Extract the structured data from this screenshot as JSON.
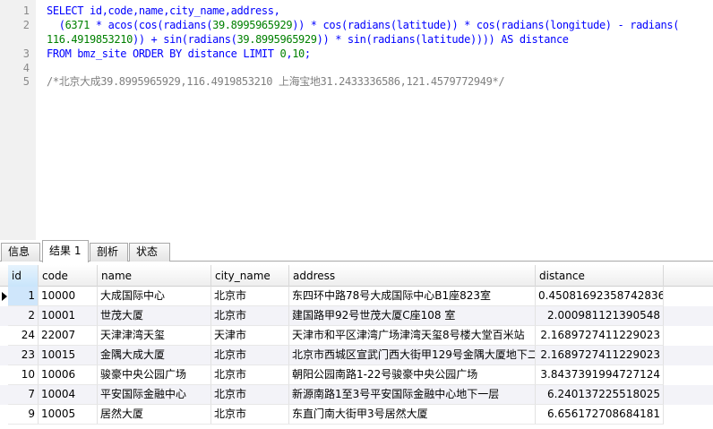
{
  "editor": {
    "lines": [
      {
        "num": "1",
        "segments": [
          {
            "text": "SELECT id,code,name,city_name,address,",
            "cls": "kw"
          }
        ]
      },
      {
        "num": "2",
        "segments": [
          {
            "text": "  (",
            "cls": "kw"
          },
          {
            "text": "6371",
            "cls": "num"
          },
          {
            "text": " * acos(cos(radians(",
            "cls": "kw"
          },
          {
            "text": "39.8995965929",
            "cls": "num"
          },
          {
            "text": ")) * cos(radians(latitude)) * cos(radians(longitude) - radians(",
            "cls": "kw"
          }
        ]
      },
      {
        "num": "",
        "segments": [
          {
            "text": "116.4919853210",
            "cls": "num"
          },
          {
            "text": ")) + sin(radians(",
            "cls": "kw"
          },
          {
            "text": "39.8995965929",
            "cls": "num"
          },
          {
            "text": ")) * sin(radians(latitude)))) AS distance",
            "cls": "kw"
          }
        ]
      },
      {
        "num": "3",
        "segments": [
          {
            "text": "FROM bmz_site ORDER BY distance LIMIT ",
            "cls": "kw"
          },
          {
            "text": "0",
            "cls": "num"
          },
          {
            "text": ",",
            "cls": "kw"
          },
          {
            "text": "10",
            "cls": "num"
          },
          {
            "text": ";",
            "cls": "kw"
          }
        ]
      },
      {
        "num": "4",
        "segments": []
      },
      {
        "num": "5",
        "segments": [
          {
            "text": "/*北京大成39.8995965929,116.4919853210 上海宝地31.2433336586,121.4579772949*/",
            "cls": "cm"
          }
        ]
      }
    ]
  },
  "tabs": [
    {
      "label": "信息",
      "active": false
    },
    {
      "label": "结果 1",
      "active": true
    },
    {
      "label": "剖析",
      "active": false
    },
    {
      "label": "状态",
      "active": false
    }
  ],
  "grid": {
    "columns": [
      "id",
      "code",
      "name",
      "city_name",
      "address",
      "distance"
    ],
    "rows": [
      [
        "1",
        "10000",
        "大成国际中心",
        "北京市",
        "东四环中路78号大成国际中心B1座823室",
        "0.45081692358742836"
      ],
      [
        "2",
        "10001",
        "世茂大厦",
        "北京市",
        "建国路甲92号世茂大厦C座108 室",
        "2.000981121390548"
      ],
      [
        "24",
        "22007",
        "天津津湾天玺",
        "天津市",
        "天津市和平区津湾广场津湾天玺8号楼大堂百米站",
        "2.1689727411229023"
      ],
      [
        "23",
        "10015",
        "金隅大成大厦",
        "北京市",
        "北京市西城区宣武门西大街甲129号金隅大厦地下二",
        "2.1689727411229023"
      ],
      [
        "10",
        "10006",
        "骏豪中央公园广场",
        "北京市",
        "朝阳公园南路1-22号骏豪中央公园广场",
        "3.8437391994727124"
      ],
      [
        "7",
        "10004",
        "平安国际金融中心",
        "北京市",
        "新源南路1至3号平安国际金融中心地下一层",
        "6.240137225518025"
      ],
      [
        "9",
        "10005",
        "居然大厦",
        "北京市",
        "东直门南大街甲3号居然大厦",
        "6.656172708684181"
      ]
    ]
  }
}
